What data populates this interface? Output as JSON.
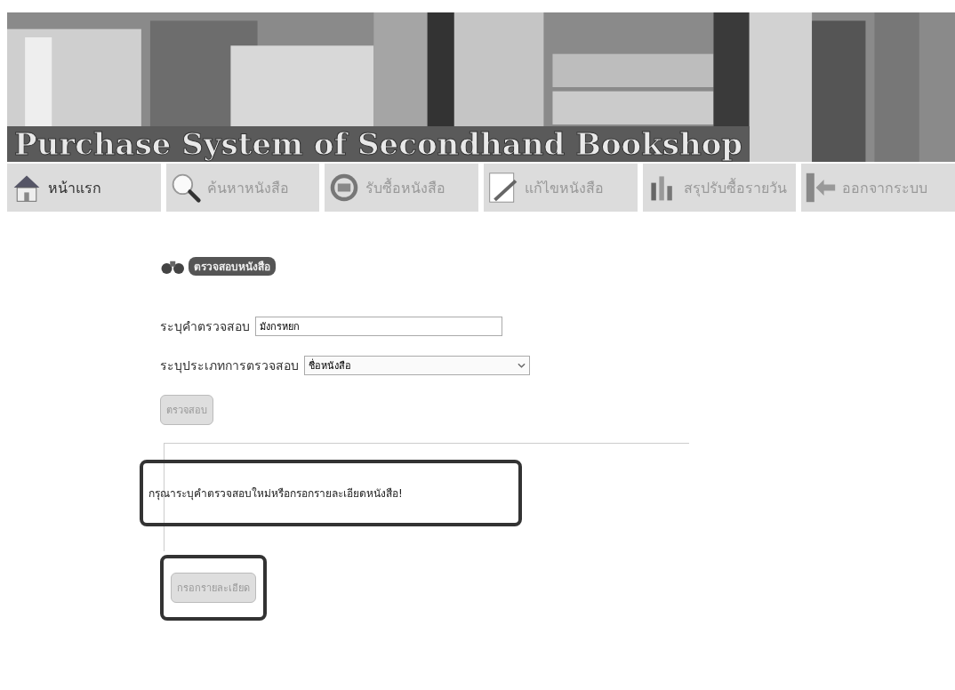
{
  "banner": {
    "title": "Purchase System of Secondhand Bookshop"
  },
  "nav": [
    {
      "label": "หน้าแรก",
      "selected": true
    },
    {
      "label": "ค้นหาหนังสือ",
      "selected": false
    },
    {
      "label": "รับซื้อหนังสือ",
      "selected": false
    },
    {
      "label": "แก้ไขหนังสือ",
      "selected": false
    },
    {
      "label": "สรุปรับซื้อรายวัน",
      "selected": false
    },
    {
      "label": "ออกจากระบบ",
      "selected": false
    }
  ],
  "form": {
    "heading": "ตรวจสอบหนังสือ",
    "keyword": {
      "label": "ระบุคำตรวจสอบ",
      "value": "มังกรหยก"
    },
    "type": {
      "label": "ระบุประเภทการตรวจสอบ",
      "value": "ชื่อหนังสือ"
    },
    "check_button": {
      "label": "ตรวจสอบ",
      "disabled": true
    }
  },
  "result": {
    "message": "กรุณาระบุคำตรวจสอบใหม่หรือกรอกรายละเอียดหนังสือ!",
    "highlighted": true,
    "button": {
      "label": "กรอกรายละเอียด",
      "disabled": true,
      "highlighted": true
    }
  }
}
